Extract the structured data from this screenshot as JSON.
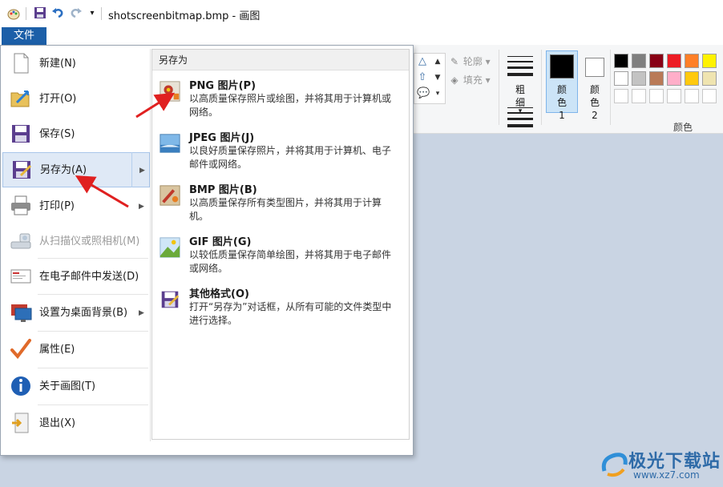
{
  "window": {
    "filename": "shotscreenbitmap.bmp",
    "app_name": "画图",
    "title_separator": " - "
  },
  "quick_access": {
    "icons": [
      "paint-app-icon",
      "save-icon",
      "undo-icon",
      "redo-icon",
      "customize-dropdown-icon"
    ]
  },
  "tabs": {
    "file": "文件"
  },
  "ribbon": {
    "outline_label": "轮廓",
    "fill_label": "填充",
    "size_label": "粗细",
    "color1_label": "颜色 1",
    "color2_label": "颜色 2",
    "colors_group_label": "颜色",
    "palette_row1": [
      "#000000",
      "#7f7f7f",
      "#880015",
      "#ed1c24",
      "#ff7f27",
      "#fff200"
    ],
    "palette_row2": [
      "#ffffff",
      "#c3c3c3",
      "#b97a57",
      "#ffaec9",
      "#ffc90e",
      "#efe4b0"
    ],
    "color1": "#000000",
    "color2": "#ffffff"
  },
  "file_menu": {
    "items": [
      {
        "label": "新建(N)",
        "icon": "new-document-icon",
        "has_submenu": false,
        "disabled": false
      },
      {
        "label": "打开(O)",
        "icon": "open-folder-icon",
        "has_submenu": false,
        "disabled": false
      },
      {
        "label": "保存(S)",
        "icon": "save-disk-icon",
        "has_submenu": false,
        "disabled": false
      },
      {
        "label": "另存为(A)",
        "icon": "save-as-icon",
        "has_submenu": true,
        "disabled": false,
        "selected": true
      },
      {
        "label": "打印(P)",
        "icon": "printer-icon",
        "has_submenu": true,
        "disabled": false
      },
      {
        "label": "从扫描仪或照相机(M)",
        "icon": "scanner-icon",
        "has_submenu": false,
        "disabled": true
      },
      {
        "label": "在电子邮件中发送(D)",
        "icon": "email-icon",
        "has_submenu": false,
        "disabled": false
      },
      {
        "label": "设置为桌面背景(B)",
        "icon": "desktop-background-icon",
        "has_submenu": true,
        "disabled": false
      },
      {
        "label": "属性(E)",
        "icon": "checkmark-icon",
        "has_submenu": false,
        "disabled": false
      },
      {
        "label": "关于画图(T)",
        "icon": "info-icon",
        "has_submenu": false,
        "disabled": false
      },
      {
        "label": "退出(X)",
        "icon": "exit-icon",
        "has_submenu": false,
        "disabled": false
      }
    ],
    "save_as_submenu": {
      "header": "另存为",
      "items": [
        {
          "title": "PNG 图片(P)",
          "description": "以高质量保存照片或绘图，并将其用于计算机或网络。",
          "icon": "png-image-icon"
        },
        {
          "title": "JPEG 图片(J)",
          "description": "以良好质量保存照片，并将其用于计算机、电子邮件或网络。",
          "icon": "jpeg-image-icon"
        },
        {
          "title": "BMP 图片(B)",
          "description": "以高质量保存所有类型图片，并将其用于计算机。",
          "icon": "bmp-image-icon"
        },
        {
          "title": "GIF 图片(G)",
          "description": "以较低质量保存简单绘图，并将其用于电子邮件或网络。",
          "icon": "gif-image-icon"
        },
        {
          "title": "其他格式(O)",
          "description": "打开“另存为”对话框，从所有可能的文件类型中进行选择。",
          "icon": "other-formats-icon"
        }
      ]
    }
  },
  "annotations": {
    "arrow_color": "#e02020"
  },
  "watermark": {
    "name": "极光下载站",
    "url": "www.xz7.com"
  }
}
